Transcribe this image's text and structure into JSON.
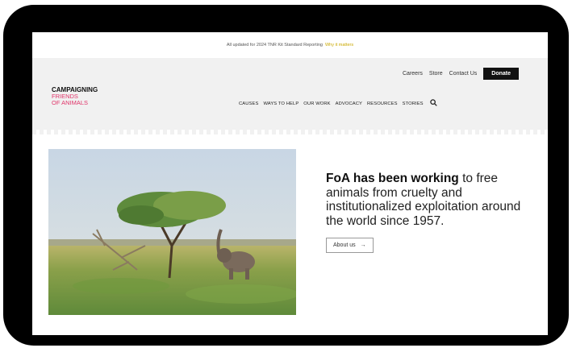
{
  "banner": {
    "text": "All updated for 2024 TNR Kit Standard Reporting",
    "link": "Why it matters"
  },
  "utility_nav": {
    "items": [
      "Careers",
      "Store",
      "Contact Us"
    ],
    "donate": "Donate"
  },
  "logo": {
    "line1": "CAMPAIGNING",
    "line2": "FRIENDS",
    "line3": "OF ANIMALS"
  },
  "main_nav": {
    "items": [
      "CAUSES",
      "WAYS TO HELP",
      "OUR WORK",
      "ADVOCACY",
      "RESOURCES",
      "STORIES"
    ]
  },
  "hero": {
    "headline_bold": "FoA has been working",
    "headline_rest": " to free animals from cruelty and institutionalized exploitation around the world since 1957.",
    "button": "About us",
    "arrow": "→"
  },
  "colors": {
    "brand_pink": "#e0356a",
    "donate_bg": "#111111",
    "banner_link": "#c9a800"
  }
}
